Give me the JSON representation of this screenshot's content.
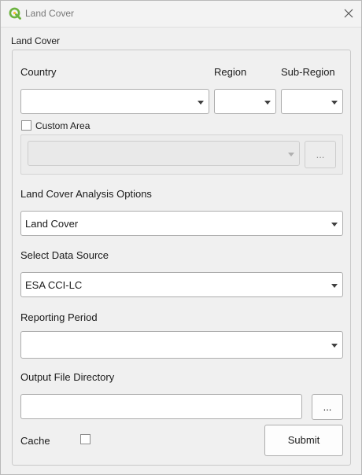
{
  "window": {
    "title": "Land Cover"
  },
  "group": {
    "title": "Land Cover"
  },
  "location": {
    "country_label": "Country",
    "region_label": "Region",
    "subregion_label": "Sub-Region",
    "country_value": "",
    "region_value": "",
    "subregion_value": "",
    "custom_area_label": "Custom Area",
    "custom_area_checked": false,
    "custom_area_value": "",
    "browse_label": "..."
  },
  "analysis": {
    "label": "Land Cover Analysis Options",
    "value": "Land Cover"
  },
  "data_source": {
    "label": "Select Data Source",
    "value": "ESA CCI-LC"
  },
  "reporting_period": {
    "label": "Reporting Period",
    "value": ""
  },
  "output": {
    "label": "Output File Directory",
    "value": "",
    "browse_label": "..."
  },
  "cache": {
    "label": "Cache",
    "checked": false
  },
  "submit": {
    "label": "Submit"
  },
  "colors": {
    "window_bg": "#f0f0f0",
    "icon_green": "#6cb33f",
    "border": "#adadad"
  }
}
